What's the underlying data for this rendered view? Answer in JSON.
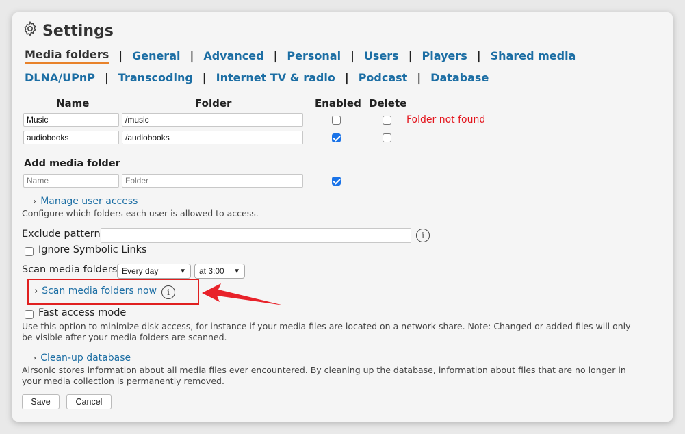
{
  "header": {
    "title": "Settings",
    "icon": "gear-icon"
  },
  "tabs_row1": [
    {
      "label": "Media folders",
      "active": true
    },
    {
      "label": "General"
    },
    {
      "label": "Advanced"
    },
    {
      "label": "Personal"
    },
    {
      "label": "Users"
    },
    {
      "label": "Players"
    },
    {
      "label": "Shared media"
    }
  ],
  "tabs_row2": [
    {
      "label": "DLNA/UPnP"
    },
    {
      "label": "Transcoding"
    },
    {
      "label": "Internet TV & radio"
    },
    {
      "label": "Podcast"
    },
    {
      "label": "Database"
    }
  ],
  "separator": "|",
  "table": {
    "headers": {
      "name": "Name",
      "folder": "Folder",
      "enabled": "Enabled",
      "delete": "Delete"
    },
    "rows": [
      {
        "name": "Music",
        "folder": "/music",
        "enabled": false,
        "delete": false,
        "status": "Folder not found"
      },
      {
        "name": "audiobooks",
        "folder": "/audiobooks",
        "enabled": true,
        "delete": false,
        "status": ""
      }
    ]
  },
  "add_folder": {
    "title": "Add media folder",
    "name_placeholder": "Name",
    "folder_placeholder": "Folder",
    "enabled": true
  },
  "manage_access": {
    "link": "Manage user access",
    "description": "Configure which folders each user is allowed to access."
  },
  "exclude": {
    "label": "Exclude pattern",
    "value": ""
  },
  "ignore_symlinks": {
    "label": "Ignore Symbolic Links",
    "checked": false
  },
  "scan": {
    "label": "Scan media folders",
    "frequency": "Every day",
    "time": "at 3:00",
    "now_link": "Scan media folders now"
  },
  "fast_access": {
    "label": "Fast access mode",
    "checked": false,
    "description": "Use this option to minimize disk access, for instance if your media files are located on a network share. Note: Changed or added files will only be visible after your media folders are scanned."
  },
  "cleanup": {
    "link": "Clean-up database",
    "description": "Airsonic stores information about all media files ever encountered. By cleaning up the database, information about files that are no longer in your media collection is permanently removed."
  },
  "buttons": {
    "save": "Save",
    "cancel": "Cancel"
  },
  "colors": {
    "link": "#1c6ea4",
    "active_underline": "#e8822a",
    "error": "#e3141c",
    "checkbox_on": "#1a73e8",
    "annotation": "#e02020"
  }
}
